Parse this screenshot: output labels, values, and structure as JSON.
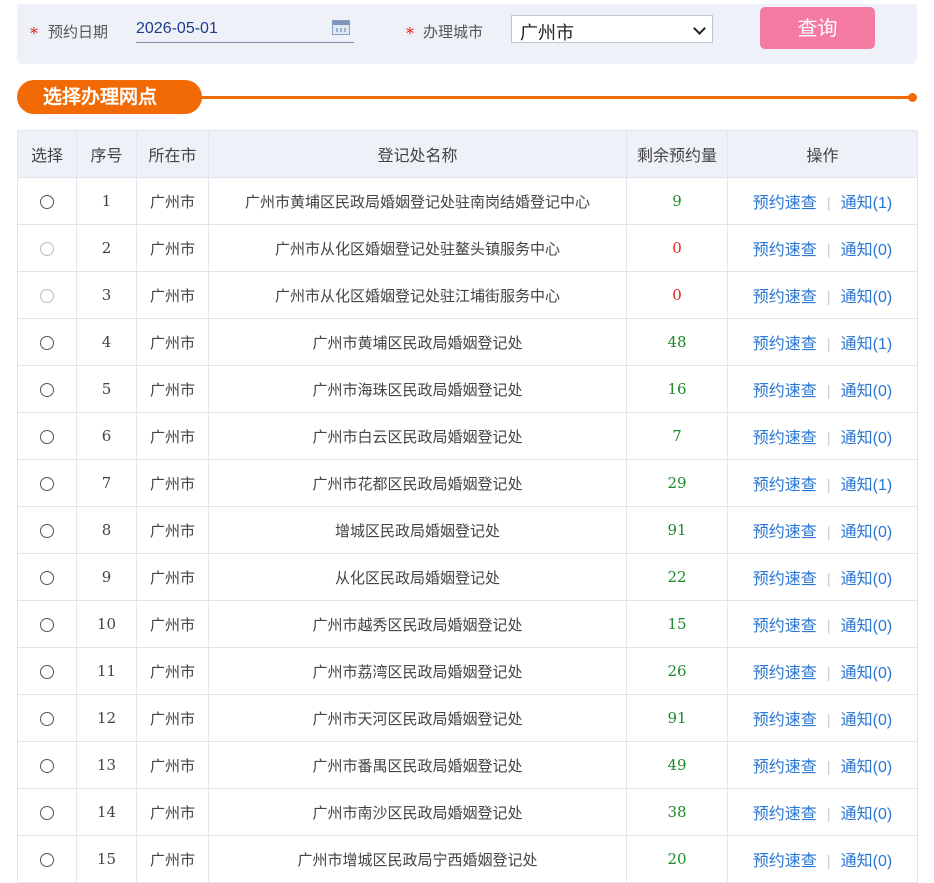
{
  "form": {
    "date_label": "预约日期",
    "date_value": "2026-05-01",
    "city_label": "办理城市",
    "city_value": "广州市",
    "query_button": "查询"
  },
  "section_title": "选择办理网点",
  "table": {
    "headers": [
      "选择",
      "序号",
      "所在市",
      "登记处名称",
      "剩余预约量",
      "操作"
    ],
    "rows": [
      {
        "no": "1",
        "city": "广州市",
        "name": "广州市黄埔区民政局婚姻登记处驻南岗结婚登记中心",
        "remaining": "9",
        "disabled": false,
        "link1": "预约速查",
        "link2": "通知(1)"
      },
      {
        "no": "2",
        "city": "广州市",
        "name": "广州市从化区婚姻登记处驻鳌头镇服务中心",
        "remaining": "0",
        "disabled": true,
        "link1": "预约速查",
        "link2": "通知(0)"
      },
      {
        "no": "3",
        "city": "广州市",
        "name": "广州市从化区婚姻登记处驻江埔街服务中心",
        "remaining": "0",
        "disabled": true,
        "link1": "预约速查",
        "link2": "通知(0)"
      },
      {
        "no": "4",
        "city": "广州市",
        "name": "广州市黄埔区民政局婚姻登记处",
        "remaining": "48",
        "disabled": false,
        "link1": "预约速查",
        "link2": "通知(1)"
      },
      {
        "no": "5",
        "city": "广州市",
        "name": "广州市海珠区民政局婚姻登记处",
        "remaining": "16",
        "disabled": false,
        "link1": "预约速查",
        "link2": "通知(0)"
      },
      {
        "no": "6",
        "city": "广州市",
        "name": "广州市白云区民政局婚姻登记处",
        "remaining": "7",
        "disabled": false,
        "link1": "预约速查",
        "link2": "通知(0)"
      },
      {
        "no": "7",
        "city": "广州市",
        "name": "广州市花都区民政局婚姻登记处",
        "remaining": "29",
        "disabled": false,
        "link1": "预约速查",
        "link2": "通知(1)"
      },
      {
        "no": "8",
        "city": "广州市",
        "name": "增城区民政局婚姻登记处",
        "remaining": "91",
        "disabled": false,
        "link1": "预约速查",
        "link2": "通知(0)"
      },
      {
        "no": "9",
        "city": "广州市",
        "name": "从化区民政局婚姻登记处",
        "remaining": "22",
        "disabled": false,
        "link1": "预约速查",
        "link2": "通知(0)"
      },
      {
        "no": "10",
        "city": "广州市",
        "name": "广州市越秀区民政局婚姻登记处",
        "remaining": "15",
        "disabled": false,
        "link1": "预约速查",
        "link2": "通知(0)"
      },
      {
        "no": "11",
        "city": "广州市",
        "name": "广州市荔湾区民政局婚姻登记处",
        "remaining": "26",
        "disabled": false,
        "link1": "预约速查",
        "link2": "通知(0)"
      },
      {
        "no": "12",
        "city": "广州市",
        "name": "广州市天河区民政局婚姻登记处",
        "remaining": "91",
        "disabled": false,
        "link1": "预约速查",
        "link2": "通知(0)"
      },
      {
        "no": "13",
        "city": "广州市",
        "name": "广州市番禺区民政局婚姻登记处",
        "remaining": "49",
        "disabled": false,
        "link1": "预约速查",
        "link2": "通知(0)"
      },
      {
        "no": "14",
        "city": "广州市",
        "name": "广州市南沙区民政局婚姻登记处",
        "remaining": "38",
        "disabled": false,
        "link1": "预约速查",
        "link2": "通知(0)"
      },
      {
        "no": "15",
        "city": "广州市",
        "name": "广州市增城区民政局宁西婚姻登记处",
        "remaining": "20",
        "disabled": false,
        "link1": "预约速查",
        "link2": "通知(0)"
      }
    ]
  },
  "colors": {
    "accent_orange": "#f26a05",
    "query_pink": "#f47aa2",
    "count_green": "#1a8a2a",
    "count_zero_red": "#e2231a",
    "link_blue": "#2a76d3"
  }
}
